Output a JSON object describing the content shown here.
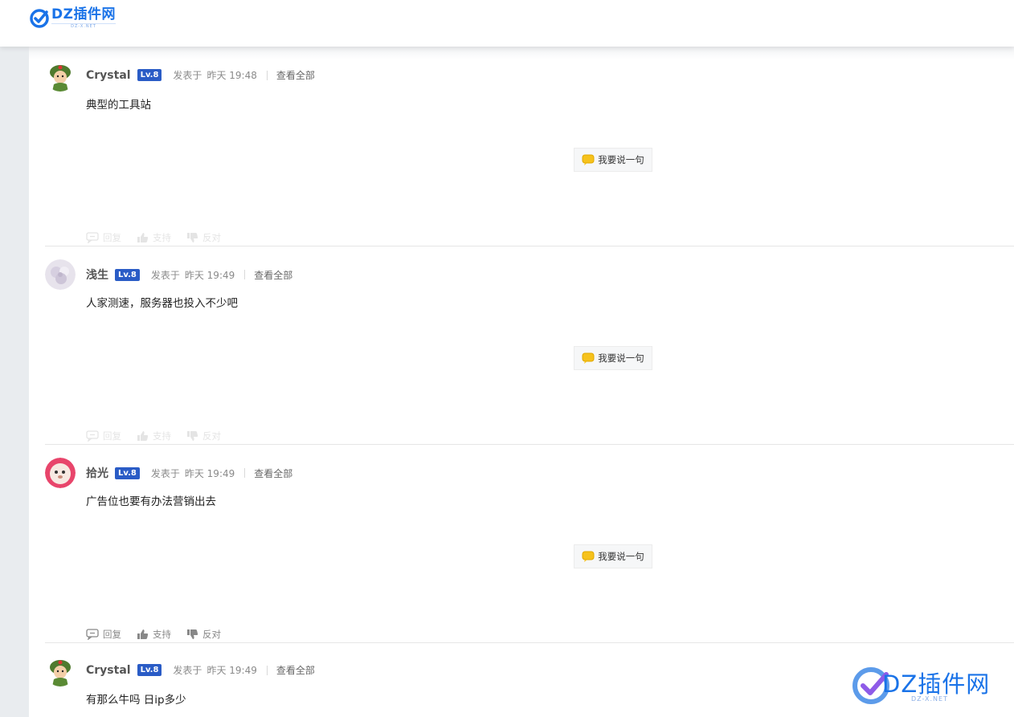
{
  "header": {
    "logo_text": "DZ插件网",
    "logo_sub": "DZ-X.NET"
  },
  "posts": [
    {
      "username": "Crystal",
      "level": "Lv.8",
      "posted_label": "发表于",
      "time": "昨天 19:48",
      "view_all": "查看全部",
      "message": "典型的工具站",
      "say_button": "我要说一句",
      "actions": {
        "reply": "回复",
        "support": "支持",
        "oppose": "反对"
      },
      "avatar": "soldier-avatar"
    },
    {
      "username": "浅生",
      "level": "Lv.8",
      "posted_label": "发表于",
      "time": "昨天 19:49",
      "view_all": "查看全部",
      "message": "人家测速，服务器也投入不少吧",
      "say_button": "我要说一句",
      "actions": {
        "reply": "回复",
        "support": "支持",
        "oppose": "反对"
      },
      "avatar": "flower-avatar"
    },
    {
      "username": "拾光",
      "level": "Lv.8",
      "posted_label": "发表于",
      "time": "昨天 19:49",
      "view_all": "查看全部",
      "message": "广告位也要有办法营销出去",
      "say_button": "我要说一句",
      "actions": {
        "reply": "回复",
        "support": "支持",
        "oppose": "反对"
      },
      "avatar": "pet-avatar"
    },
    {
      "username": "Crystal",
      "level": "Lv.8",
      "posted_label": "发表于",
      "time": "昨天 19:49",
      "view_all": "查看全部",
      "message": "有那么牛吗 日ip多少",
      "avatar": "soldier-avatar"
    }
  ],
  "watermark": {
    "text": "DZ插件网",
    "sub": "DZ-X.NET"
  },
  "colors": {
    "brand": "#1a73e8",
    "level_badge": "#2a5cc6",
    "rail": "#e9ecef"
  }
}
